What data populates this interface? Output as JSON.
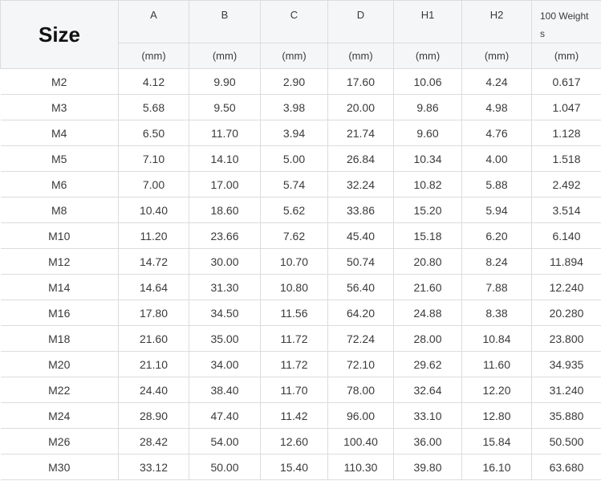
{
  "table": {
    "size_header": "Size",
    "columns": [
      "A",
      "B",
      "C",
      "D",
      "H1",
      "H2",
      "100 Weights"
    ],
    "weight_header_line1": "100 Weight",
    "weight_header_line2": "s",
    "units": [
      "(mm)",
      "(mm)",
      "(mm)",
      "(mm)",
      "(mm)",
      "(mm)",
      "(mm)"
    ],
    "rows": [
      {
        "size": "M2",
        "A": "4.12",
        "B": "9.90",
        "C": "2.90",
        "D": "17.60",
        "H1": "10.06",
        "H2": "4.24",
        "W": "0.617"
      },
      {
        "size": "M3",
        "A": "5.68",
        "B": "9.50",
        "C": "3.98",
        "D": "20.00",
        "H1": "9.86",
        "H2": "4.98",
        "W": "1.047"
      },
      {
        "size": "M4",
        "A": "6.50",
        "B": "11.70",
        "C": "3.94",
        "D": "21.74",
        "H1": "9.60",
        "H2": "4.76",
        "W": "1.128"
      },
      {
        "size": "M5",
        "A": "7.10",
        "B": "14.10",
        "C": "5.00",
        "D": "26.84",
        "H1": "10.34",
        "H2": "4.00",
        "W": "1.518"
      },
      {
        "size": "M6",
        "A": "7.00",
        "B": "17.00",
        "C": "5.74",
        "D": "32.24",
        "H1": "10.82",
        "H2": "5.88",
        "W": "2.492"
      },
      {
        "size": "M8",
        "A": "10.40",
        "B": "18.60",
        "C": "5.62",
        "D": "33.86",
        "H1": "15.20",
        "H2": "5.94",
        "W": "3.514"
      },
      {
        "size": "M10",
        "A": "11.20",
        "B": "23.66",
        "C": "7.62",
        "D": "45.40",
        "H1": "15.18",
        "H2": "6.20",
        "W": "6.140"
      },
      {
        "size": "M12",
        "A": "14.72",
        "B": "30.00",
        "C": "10.70",
        "D": "50.74",
        "H1": "20.80",
        "H2": "8.24",
        "W": "11.894"
      },
      {
        "size": "M14",
        "A": "14.64",
        "B": "31.30",
        "C": "10.80",
        "D": "56.40",
        "H1": "21.60",
        "H2": "7.88",
        "W": "12.240"
      },
      {
        "size": "M16",
        "A": "17.80",
        "B": "34.50",
        "C": "11.56",
        "D": "64.20",
        "H1": "24.88",
        "H2": "8.38",
        "W": "20.280"
      },
      {
        "size": "M18",
        "A": "21.60",
        "B": "35.00",
        "C": "11.72",
        "D": "72.24",
        "H1": "28.00",
        "H2": "10.84",
        "W": "23.800"
      },
      {
        "size": "M20",
        "A": "21.10",
        "B": "34.00",
        "C": "11.72",
        "D": "72.10",
        "H1": "29.62",
        "H2": "11.60",
        "W": "34.935"
      },
      {
        "size": "M22",
        "A": "24.40",
        "B": "38.40",
        "C": "11.70",
        "D": "78.00",
        "H1": "32.64",
        "H2": "12.20",
        "W": "31.240"
      },
      {
        "size": "M24",
        "A": "28.90",
        "B": "47.40",
        "C": "11.42",
        "D": "96.00",
        "H1": "33.10",
        "H2": "12.80",
        "W": "35.880"
      },
      {
        "size": "M26",
        "A": "28.42",
        "B": "54.00",
        "C": "12.60",
        "D": "100.40",
        "H1": "36.00",
        "H2": "15.84",
        "W": "50.500"
      },
      {
        "size": "M30",
        "A": "33.12",
        "B": "50.00",
        "C": "15.40",
        "D": "110.30",
        "H1": "39.80",
        "H2": "16.10",
        "W": "63.680"
      }
    ]
  }
}
